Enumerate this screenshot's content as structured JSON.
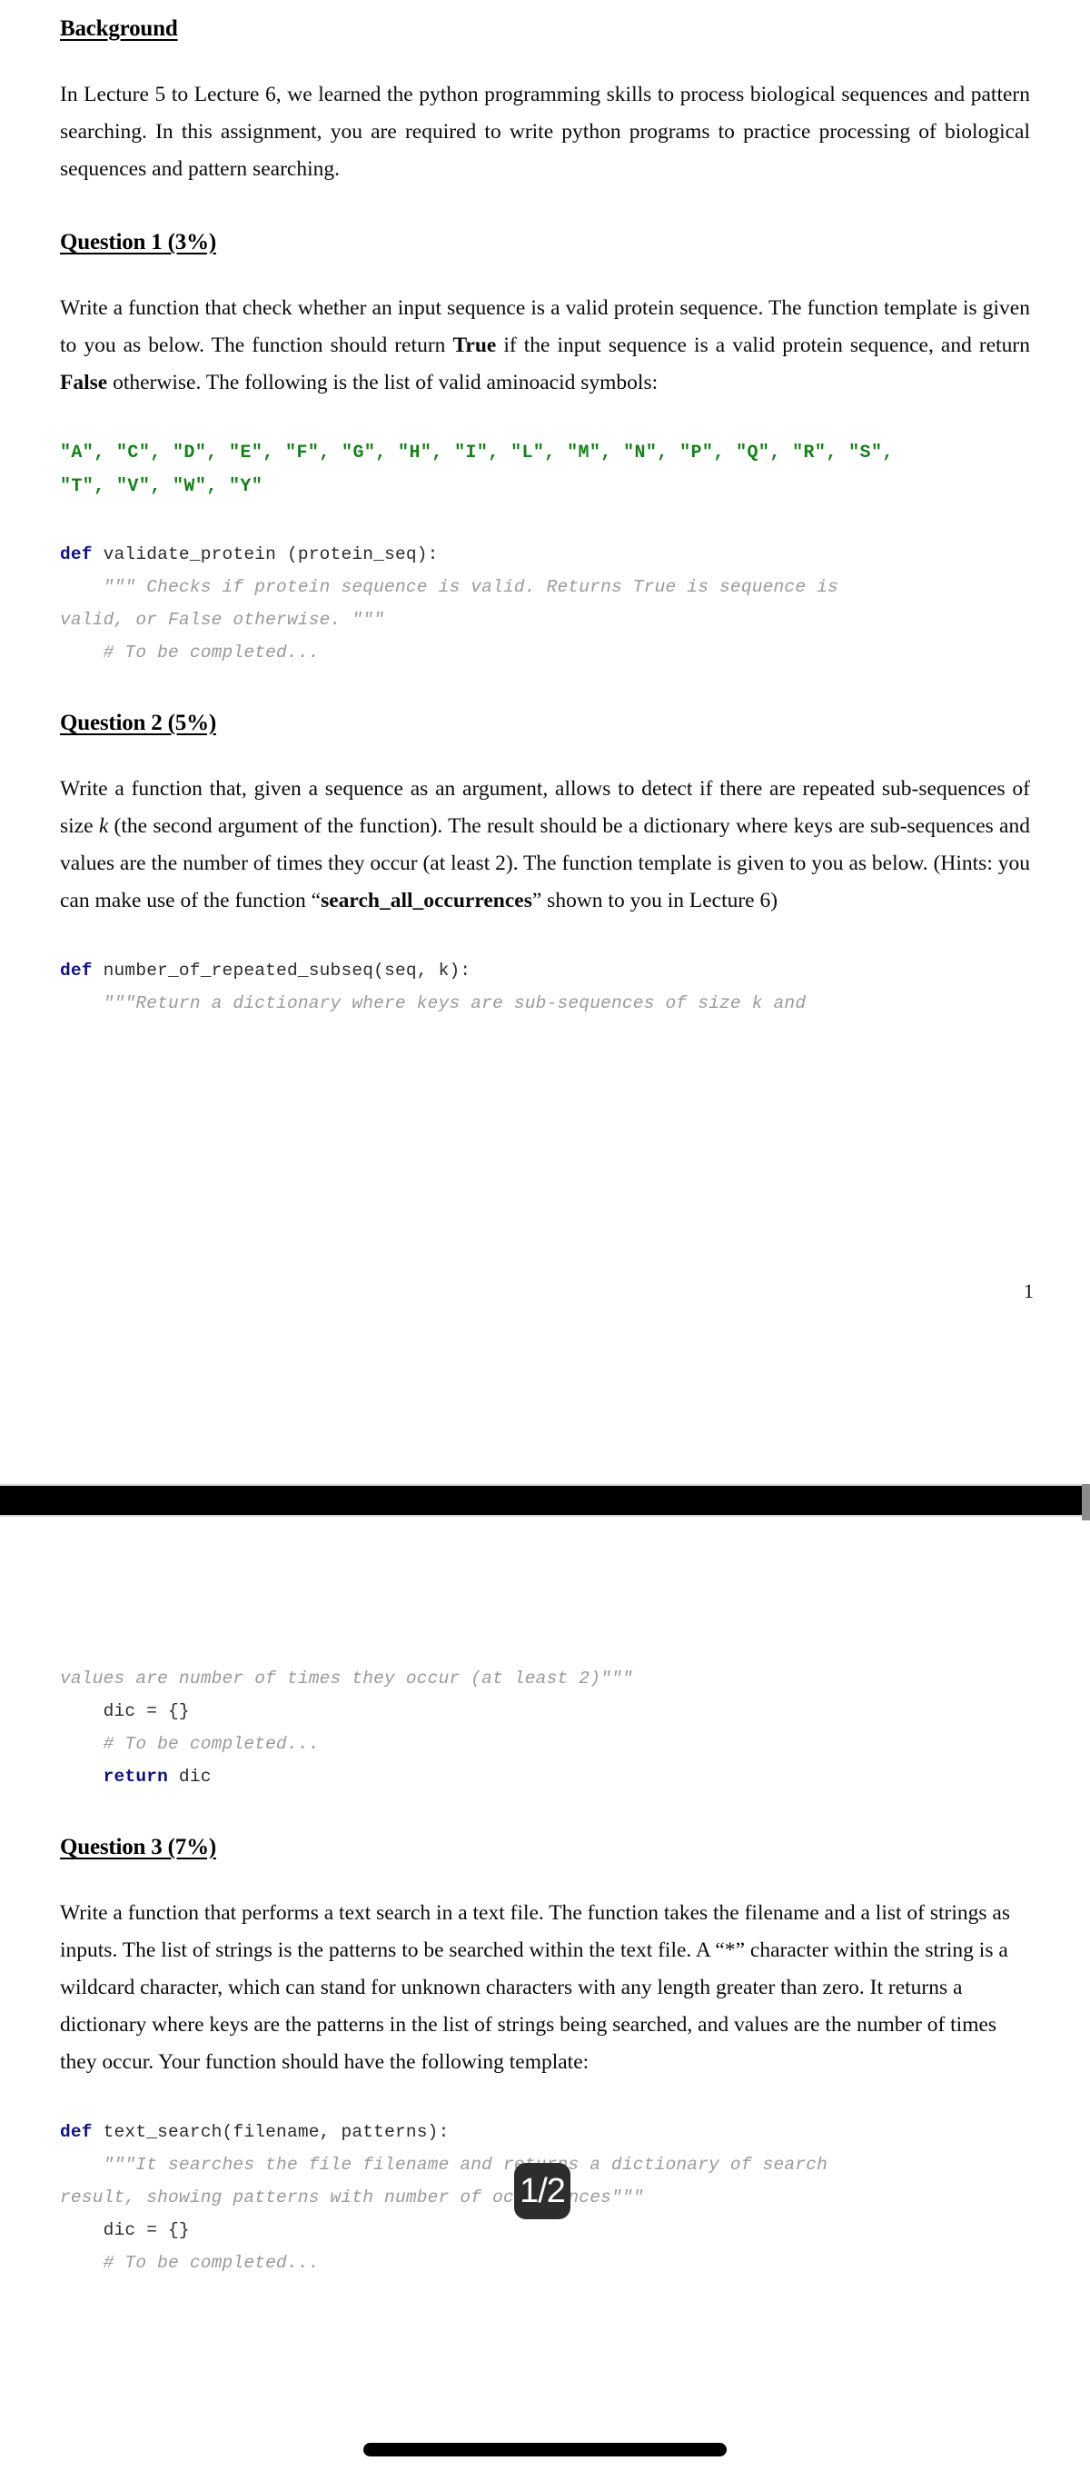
{
  "document": {
    "page_number_label": "1",
    "page_indicator": "1/2",
    "sections": {
      "background": {
        "heading": "Background",
        "body": "In Lecture 5 to Lecture 6, we learned the python programming skills to process biological sequences and pattern searching. In this assignment, you are required to write python programs to practice processing of biological sequences and pattern searching."
      },
      "question1": {
        "heading": "Question 1 (3%)",
        "body_part1": "Write a function that check whether an input sequence is a valid protein sequence. The function template is given to you as below. The function should return ",
        "body_bold1": "True",
        "body_part2": " if the input sequence is a valid protein sequence, and return ",
        "body_bold2": "False",
        "body_part3": " otherwise. The following is the list of valid aminoacid symbols:",
        "aminoacid_line1": "\"A\", \"C\", \"D\", \"E\", \"F\", \"G\", \"H\", \"I\", \"L\", \"M\", \"N\", \"P\", \"Q\", \"R\", \"S\",",
        "aminoacid_line2": "\"T\", \"V\", \"W\", \"Y\"",
        "code": {
          "def_keyword": "def",
          "signature": " validate_protein (protein_seq):",
          "docstring_line1": "    \"\"\" Checks if protein sequence is valid. Returns True is sequence is",
          "docstring_line2": "valid, or False otherwise. \"\"\"",
          "comment": "    # To be completed..."
        }
      },
      "question2": {
        "heading": "Question 2 (5%)",
        "body_part1": "Write a function that, given a sequence as an argument, allows to detect if there are repeated sub-sequences of size ",
        "body_italic1": "k",
        "body_part2": " (the second argument of the function). The result should be a dictionary where keys are sub-sequences and values are the number of times they occur (at least 2). The function template is given to you as below. (Hints: you can make use of the function “",
        "body_bold1": "search_all_occurrences",
        "body_part3": "” shown to you in Lecture 6)",
        "code": {
          "def_keyword": "def",
          "signature": " number_of_repeated_subseq(seq, k):",
          "docstring_line1": "    \"\"\"Return a dictionary where keys are sub-sequences of size k and",
          "docstring_line2": "values are number of times they occur (at least 2)\"\"\"",
          "assign_line": "    dic = {}",
          "comment": "    # To be completed...",
          "return_keyword": "    return",
          "return_value": " dic"
        }
      },
      "question3": {
        "heading": "Question 3 (7%)",
        "body": "Write a function that performs a text search in a text file. The function takes the filename and a list of strings as inputs. The list of strings is the patterns to be searched within the text file. A “*” character within the string is a wildcard character, which can stand for unknown characters with any length greater than zero. It returns a dictionary where keys are the patterns in the list of strings being searched, and values are the number of times they occur. Your function should have the following template:",
        "code": {
          "def_keyword": "def",
          "signature": " text_search(filename, patterns):",
          "docstring_line1": "    \"\"\"It searches the file filename and returns a dictionary of search",
          "docstring_line2": "result, showing patterns with number of occurrences\"\"\"",
          "assign_line": "    dic = {}",
          "comment": "    # To be completed..."
        }
      }
    }
  },
  "colors": {
    "keyword": "#11117f",
    "string_green": "#17801b",
    "comment_gray": "#9a9a9a",
    "page_indicator_bg": "#2d2d2d"
  }
}
